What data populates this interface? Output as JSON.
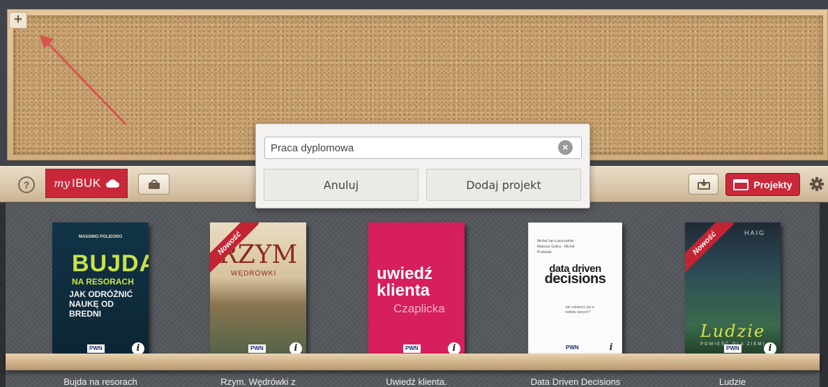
{
  "corkboard": {
    "add_label": "+"
  },
  "toolbar": {
    "help_label": "?",
    "myibuk_my": "my",
    "myibuk_ibuk": "IBUK",
    "projects_label": "Projekty"
  },
  "dialog": {
    "input_value": "Praca dyplomowa",
    "clear_label": "×",
    "cancel_label": "Anuluj",
    "add_label": "Dodaj projekt"
  },
  "books": [
    {
      "title": "Bujda na resorach",
      "cover_author": "MASSIMO POLIDORO",
      "cover_t1": "BUJDA",
      "cover_t2": "NA RESORACH",
      "cover_t3": "JAK ODRÓŻNIĆ NAUKĘ OD BREDNI",
      "publisher": "PWN"
    },
    {
      "title": "Rzym. Wędrówki z",
      "ribbon": "Nowość",
      "cover_t1": "RZYM",
      "cover_t2": "WĘDRÓWKI",
      "publisher": "PWN"
    },
    {
      "title": "Uwiedź klienta.",
      "cover_t1": "uwiedź klienta",
      "cover_t2": "Czaplicka",
      "publisher": "PWN"
    },
    {
      "title": "Data Driven Decisions",
      "cover_auth": "Michał Jan Łuszczański · Mateusz Gulica · Michał Protasiuk",
      "cover_t1a": "data driven",
      "cover_t1b": "decisions",
      "cover_q": "Jak odnaleźć się w natłoku danych?",
      "publisher": "PWN"
    },
    {
      "title": "Ludzie",
      "ribbon": "Nowość",
      "cover_auth": "HAIG",
      "cover_t1": "Ludzie",
      "cover_t2": "POWIEŚĆ DLA ZIEMI",
      "publisher": "PWN"
    }
  ],
  "info_label": "i",
  "colors": {
    "accent_red": "#c9283a",
    "cork": "#c8a170",
    "shelf": "#55585d"
  },
  "icons": [
    "plus-icon",
    "help-icon",
    "cloud-icon",
    "basket-icon",
    "download-icon",
    "projects-icon",
    "gear-icon",
    "clear-icon",
    "info-icon",
    "annotation-arrow-icon"
  ]
}
